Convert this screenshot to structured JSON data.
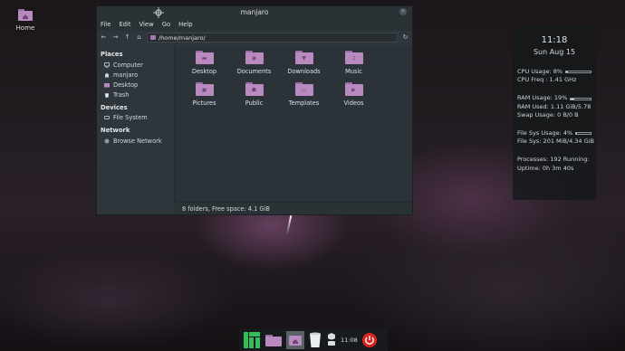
{
  "desktop": {
    "home_label": "Home"
  },
  "window": {
    "title": "manjaro",
    "menu": [
      "File",
      "Edit",
      "View",
      "Go",
      "Help"
    ],
    "path": "/home/manjaro/",
    "sidebar": {
      "places_heading": "Places",
      "places": [
        {
          "label": "Computer",
          "icon": "computer-icon"
        },
        {
          "label": "manjaro",
          "icon": "home-icon"
        },
        {
          "label": "Desktop",
          "icon": "desktop-folder-icon"
        },
        {
          "label": "Trash",
          "icon": "trash-icon"
        }
      ],
      "devices_heading": "Devices",
      "devices": [
        {
          "label": "File System",
          "icon": "drive-icon"
        }
      ],
      "network_heading": "Network",
      "network": [
        {
          "label": "Browse Network",
          "icon": "network-icon"
        }
      ]
    },
    "folders": [
      {
        "name": "Desktop",
        "icon": "desktop-folder-icon"
      },
      {
        "name": "Documents",
        "icon": "documents-folder-icon"
      },
      {
        "name": "Downloads",
        "icon": "downloads-folder-icon"
      },
      {
        "name": "Music",
        "icon": "music-folder-icon"
      },
      {
        "name": "Pictures",
        "icon": "pictures-folder-icon"
      },
      {
        "name": "Public",
        "icon": "public-folder-icon"
      },
      {
        "name": "Templates",
        "icon": "templates-folder-icon"
      },
      {
        "name": "Videos",
        "icon": "videos-folder-icon"
      }
    ],
    "status": "8 folders, Free space: 4.1 GiB"
  },
  "conky": {
    "time": "11:18",
    "date": "Sun Aug 15",
    "cpu_usage": "CPU Usage: 8%",
    "cpu_usage_fraction": 0.08,
    "cpu_freq": "CPU Freq : 1.41 GHz",
    "ram_usage": "RAM Usage: 19%",
    "ram_usage_fraction": 0.19,
    "ram_used": "RAM Used: 1.11 GiB/5.78",
    "swap_usage": "Swap Usage: 0 B/0 B",
    "fs_usage": "File Sys Usage:  4%",
    "fs_usage_fraction": 0.04,
    "fs_sys": "File Sys: 201 MiB/4.34 GiB",
    "processes": "Processes: 192   Running:",
    "uptime": "Uptime: 0h 3m 40s"
  },
  "taskbar": {
    "clock": "11:08"
  },
  "colors": {
    "folder": "#b98ac0",
    "manjaro_green": "#35bf5c",
    "power_red": "#d9231f"
  }
}
